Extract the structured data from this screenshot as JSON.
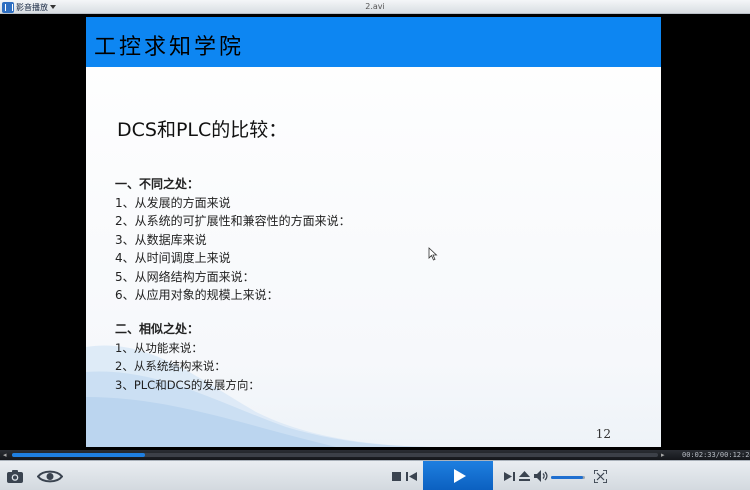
{
  "window": {
    "menu_label": "影音播放",
    "file_name": "2.avi"
  },
  "slide": {
    "header_title": "工控求知学院",
    "heading": "DCS和PLC的比较：",
    "section1": {
      "title": "一、不同之处：",
      "items": [
        "1、从发展的方面来说",
        "2、从系统的可扩展性和兼容性的方面来说：",
        "3、从数据库来说",
        "4、从时间调度上来说",
        "5、从网络结构方面来说：",
        "6、从应用对象的规模上来说："
      ]
    },
    "section2": {
      "title": "二、相似之处：",
      "items": [
        "1、从功能来说：",
        "2、从系统结构来说：",
        "3、PLC和DCS的发展方向："
      ]
    },
    "page_number": "12"
  },
  "player": {
    "time": "00:02:33/00:12:24",
    "progress_fraction": 0.206,
    "volume_fraction": 0.95,
    "accent_color": "#1f7fe0"
  }
}
